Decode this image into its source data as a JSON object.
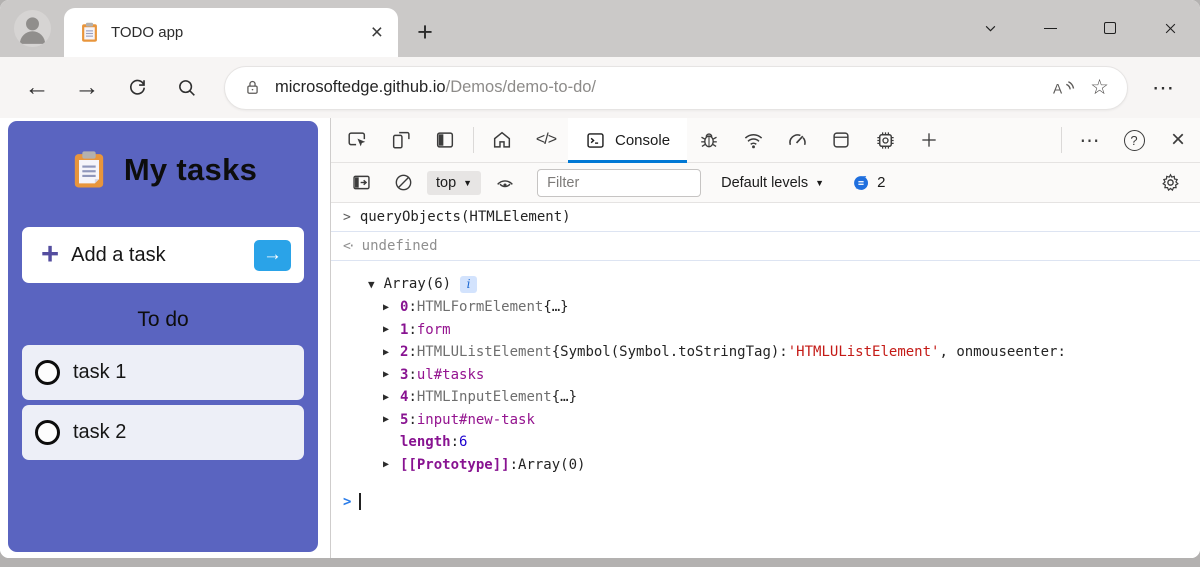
{
  "colors": {
    "accent": "#0078d4",
    "panel_purple": "#5a64c0",
    "go_button_blue": "#2aa3e8",
    "key_purple": "#881391",
    "node_magenta": "#94138f",
    "string_red": "#c41a16",
    "number_blue": "#1c00cf",
    "titlebar_gray": "#cbc9c8"
  },
  "titlebar": {
    "tab_title": "TODO app",
    "tab_close": "×",
    "new_tab": "+"
  },
  "navbar": {
    "back": "←",
    "forward": "→",
    "url_host": "microsoftedge.github.io",
    "url_path": "/Demos/demo-to-do/",
    "star": "☆",
    "more": "⋯"
  },
  "todo_app": {
    "title": "My tasks",
    "add_task_label": "Add a task",
    "plus": "+",
    "go_arrow": "→",
    "section_title": "To do",
    "tasks": [
      "task 1",
      "task 2"
    ]
  },
  "devtools": {
    "console_tab_label": "Console",
    "code_tab_glyph": "</>",
    "more": "⋯",
    "help": "?",
    "close": "×",
    "toolbar": {
      "context": "top",
      "context_arrow": "▼",
      "filter_placeholder": "Filter",
      "levels_label": "Default levels",
      "levels_arrow": "▼",
      "messages_count": "2"
    },
    "console": {
      "echo_chevron": ">",
      "echo": "queryObjects(HTMLElement)",
      "result_arrow": "<·",
      "result": "undefined",
      "array_triangle": "▼",
      "array_label": "Array(6)",
      "info_badge": "i",
      "entry_triangle": "▶",
      "entries": [
        {
          "expandable": true,
          "parts": [
            {
              "t": "0",
              "s": "key"
            },
            {
              "t": ": ",
              "s": "plain"
            },
            {
              "t": "HTMLFormElement ",
              "s": "class"
            },
            {
              "t": "{…}",
              "s": "plain"
            }
          ]
        },
        {
          "expandable": true,
          "parts": [
            {
              "t": "1",
              "s": "key"
            },
            {
              "t": ": ",
              "s": "plain"
            },
            {
              "t": "form",
              "s": "node"
            }
          ]
        },
        {
          "expandable": true,
          "parts": [
            {
              "t": "2",
              "s": "key"
            },
            {
              "t": ": ",
              "s": "plain"
            },
            {
              "t": "HTMLUListElement ",
              "s": "class"
            },
            {
              "t": "{Symbol(Symbol.toStringTag): ",
              "s": "plain"
            },
            {
              "t": "'HTMLUListElement'",
              "s": "string"
            },
            {
              "t": ", onmouseenter:",
              "s": "plain"
            }
          ]
        },
        {
          "expandable": true,
          "parts": [
            {
              "t": "3",
              "s": "key"
            },
            {
              "t": ": ",
              "s": "plain"
            },
            {
              "t": "ul#tasks",
              "s": "node"
            }
          ]
        },
        {
          "expandable": true,
          "parts": [
            {
              "t": "4",
              "s": "key"
            },
            {
              "t": ": ",
              "s": "plain"
            },
            {
              "t": "HTMLInputElement ",
              "s": "class"
            },
            {
              "t": "{…}",
              "s": "plain"
            }
          ]
        },
        {
          "expandable": true,
          "parts": [
            {
              "t": "5",
              "s": "key"
            },
            {
              "t": ": ",
              "s": "plain"
            },
            {
              "t": "input#new-task",
              "s": "node"
            }
          ]
        },
        {
          "expandable": false,
          "parts": [
            {
              "t": "length",
              "s": "key"
            },
            {
              "t": ": ",
              "s": "plain"
            },
            {
              "t": "6",
              "s": "number"
            }
          ]
        },
        {
          "expandable": true,
          "parts": [
            {
              "t": "[[Prototype]]",
              "s": "key"
            },
            {
              "t": ": ",
              "s": "plain"
            },
            {
              "t": "Array(0)",
              "s": "plain"
            }
          ]
        }
      ],
      "prompt_chevron": ">"
    }
  }
}
